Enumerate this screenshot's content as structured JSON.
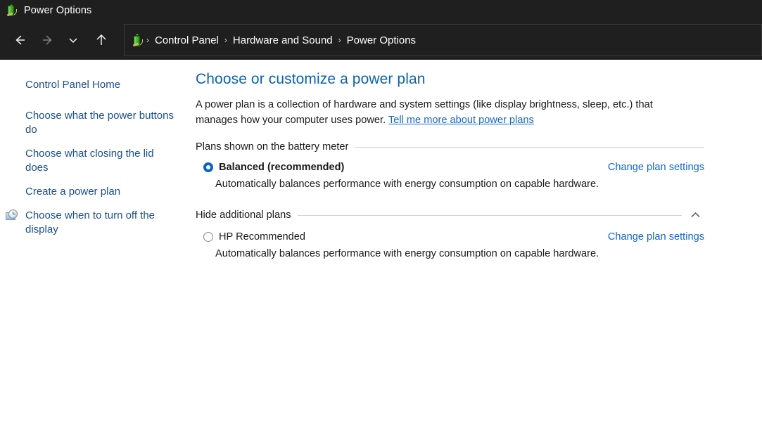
{
  "window": {
    "title": "Power Options",
    "icon": "battery-power-icon"
  },
  "toolbar": {
    "back": "back-arrow-icon",
    "forward": "forward-arrow-icon",
    "recent": "chevron-down-icon",
    "up": "up-arrow-icon",
    "address_icon": "battery-power-icon",
    "breadcrumbs": [
      {
        "label": "Control Panel"
      },
      {
        "label": "Hardware and Sound"
      },
      {
        "label": "Power Options"
      }
    ],
    "separator": "›"
  },
  "sidebar": {
    "items": [
      {
        "label": "Control Panel Home",
        "icon": null
      },
      {
        "label": "Choose what the power buttons do",
        "icon": null
      },
      {
        "label": "Choose what closing the lid does",
        "icon": null
      },
      {
        "label": "Create a power plan",
        "icon": null
      },
      {
        "label": "Choose when to turn off the display",
        "icon": "clock-display-icon"
      }
    ]
  },
  "main": {
    "heading": "Choose or customize a power plan",
    "intro_text": "A power plan is a collection of hardware and system settings (like display brightness, sleep, etc.) that manages how your computer uses power. ",
    "intro_link": "Tell me more about power plans",
    "sections": [
      {
        "header": "Plans shown on the battery meter",
        "collapsible": false,
        "collapse_icon": null,
        "plans": [
          {
            "name": "Balanced (recommended)",
            "selected": true,
            "bold": true,
            "link": "Change plan settings",
            "description": "Automatically balances performance with energy consumption on capable hardware."
          }
        ]
      },
      {
        "header": "Hide additional plans",
        "collapsible": true,
        "collapse_icon": "chevron-up-icon",
        "plans": [
          {
            "name": "HP Recommended",
            "selected": false,
            "bold": false,
            "link": "Change plan settings",
            "description": "Automatically balances performance with energy consumption on capable hardware."
          }
        ]
      }
    ]
  },
  "colors": {
    "titlebar_bg": "#1f1f1f",
    "link": "#1166cc",
    "heading": "#0b62b0",
    "radio_selected": "#0a64c8",
    "sidebar_link": "#1a4f8f"
  }
}
